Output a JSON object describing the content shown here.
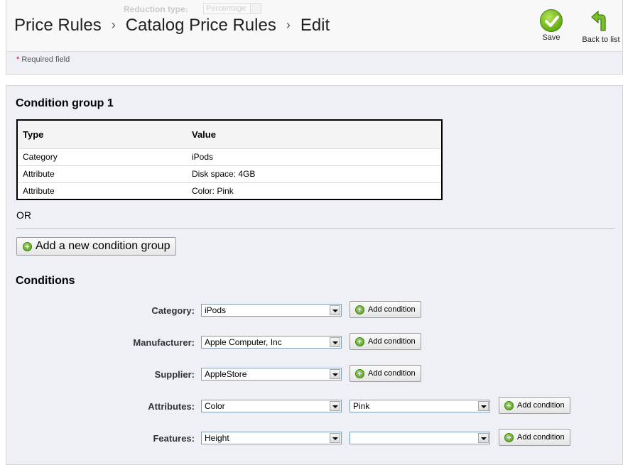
{
  "header": {
    "ghost_field_label": "Reduction type:",
    "ghost_field_value": "Percentage",
    "breadcrumb": [
      "Price Rules",
      "Catalog Price Rules",
      "Edit"
    ],
    "breadcrumb_separator": "›",
    "required_star": "*",
    "required_text": "Required field",
    "save_label": "Save",
    "back_label": "Back to list"
  },
  "group": {
    "title": "Condition group 1",
    "columns": [
      "Type",
      "Value"
    ],
    "rows": [
      {
        "type": "Category",
        "value": "iPods"
      },
      {
        "type": "Attribute",
        "value": "Disk space: 4GB"
      },
      {
        "type": "Attribute",
        "value": "Color: Pink"
      }
    ]
  },
  "or_label": "OR",
  "add_group_label": "Add a new condition group",
  "conditions": {
    "title": "Conditions",
    "add_label": "Add condition",
    "rows": [
      {
        "label": "Category:",
        "value": "iPods"
      },
      {
        "label": "Manufacturer:",
        "value": "Apple Computer, Inc"
      },
      {
        "label": "Supplier:",
        "value": "AppleStore"
      },
      {
        "label": "Attributes:",
        "value": "Color",
        "value2": "Pink"
      },
      {
        "label": "Features:",
        "value": "Height",
        "value2": ""
      }
    ]
  },
  "colors": {
    "panel_bg": "#eef0f6",
    "accent_green": "#6fb51c"
  }
}
